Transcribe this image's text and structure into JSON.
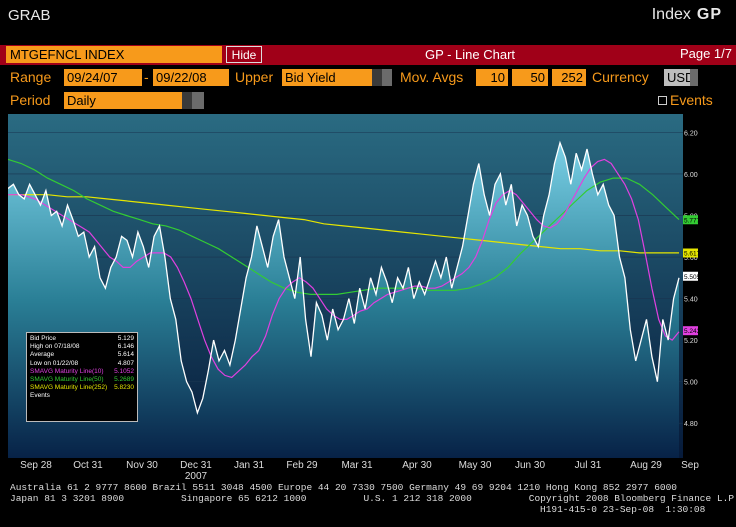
{
  "header": {
    "app_label": "GRAB",
    "index_label": "Index",
    "index_code": "GP"
  },
  "toolbar": {
    "ticker": "MTGEFNCL INDEX",
    "hide_label": "Hide",
    "chart_title": "GP - Line Chart",
    "page": "Page 1/7"
  },
  "controls": {
    "range_label": "Range",
    "range_start": "09/24/07",
    "range_sep": "-",
    "range_end": "09/22/08",
    "upper_label": "Upper",
    "upper_value": "Bid Yield",
    "movavg_label": "Mov. Avgs",
    "movavg_1": "10",
    "movavg_2": "50",
    "movavg_3": "252",
    "currency_label": "Currency",
    "currency_value": "USD",
    "period_label": "Period",
    "period_value": "Daily",
    "events_label": "Events"
  },
  "legend": [
    {
      "label": "Bid Price",
      "value": "5.129",
      "color": "#ffffff"
    },
    {
      "label": "High on 07/18/08",
      "value": "6.146",
      "color": "#ffffff"
    },
    {
      "label": "Average",
      "value": "5.614",
      "color": "#ffffff"
    },
    {
      "label": "Low on 01/22/08",
      "value": "4.807",
      "color": "#ffffff"
    },
    {
      "label": "SMAVG Maturity Line(10)",
      "value": "5.1052",
      "color": "#e040e0"
    },
    {
      "label": "SMAVG Maturity Line(50)",
      "value": "5.2689",
      "color": "#33cc33"
    },
    {
      "label": "SMAVG Maturity Line(252)",
      "value": "5.8230",
      "color": "#e6e600"
    },
    {
      "label": "Events",
      "value": "",
      "color": "#ffffff"
    }
  ],
  "chart_data": {
    "type": "line",
    "y_ticks": [
      "6.200",
      "6.000",
      "5.800",
      "5.600",
      "5.400",
      "5.200",
      "5.000",
      "4.800"
    ],
    "ylim": [
      4.7,
      6.25
    ],
    "x_labels": [
      "Sep 28",
      "Oct 31",
      "Nov 30",
      "Dec 31",
      "Jan 31",
      "Feb 29",
      "Mar 31",
      "Apr 30",
      "May 30",
      "Jun 30",
      "Jul 31",
      "Aug 29",
      "Sep"
    ],
    "year_label": "2007",
    "right_markers": [
      {
        "text": "5.777",
        "color": "#33cc33"
      },
      {
        "text": "5.617",
        "color": "#e6e600"
      },
      {
        "text": "5.505",
        "color": "#ffffff"
      },
      {
        "text": "5.243",
        "color": "#e040e0"
      }
    ],
    "series": [
      {
        "name": "Bid Price",
        "color": "#ffffff",
        "values": [
          5.93,
          5.95,
          5.9,
          5.88,
          5.95,
          5.9,
          5.85,
          5.92,
          5.8,
          5.82,
          5.75,
          5.85,
          5.78,
          5.7,
          5.72,
          5.6,
          5.65,
          5.5,
          5.45,
          5.55,
          5.6,
          5.7,
          5.68,
          5.6,
          5.72,
          5.65,
          5.55,
          5.7,
          5.75,
          5.6,
          5.4,
          5.3,
          5.1,
          5.0,
          4.95,
          4.85,
          4.92,
          5.05,
          5.2,
          5.1,
          5.15,
          5.08,
          5.2,
          5.35,
          5.5,
          5.6,
          5.75,
          5.65,
          5.55,
          5.7,
          5.78,
          5.6,
          5.5,
          5.4,
          5.6,
          5.3,
          5.12,
          5.38,
          5.32,
          5.2,
          5.35,
          5.25,
          5.3,
          5.4,
          5.28,
          5.45,
          5.35,
          5.5,
          5.42,
          5.55,
          5.48,
          5.38,
          5.5,
          5.45,
          5.55,
          5.4,
          5.48,
          5.42,
          5.5,
          5.58,
          5.5,
          5.6,
          5.45,
          5.55,
          5.65,
          5.8,
          5.95,
          6.05,
          5.9,
          5.8,
          5.95,
          6.0,
          5.85,
          5.95,
          5.75,
          5.85,
          5.8,
          5.7,
          5.65,
          5.8,
          5.9,
          6.05,
          6.15,
          6.08,
          5.95,
          6.1,
          6.02,
          6.12,
          6.0,
          5.9,
          5.95,
          5.85,
          5.8,
          5.6,
          5.5,
          5.25,
          5.1,
          5.2,
          5.3,
          5.12,
          5.0,
          5.3,
          5.2,
          5.4,
          5.5
        ]
      },
      {
        "name": "SMAVG Maturity Line(10)",
        "color": "#e040e0",
        "values": [
          5.9,
          5.9,
          5.9,
          5.89,
          5.88,
          5.86,
          5.84,
          5.82,
          5.8,
          5.78,
          5.76,
          5.74,
          5.72,
          5.68,
          5.64,
          5.6,
          5.58,
          5.55,
          5.55,
          5.58,
          5.6,
          5.62,
          5.62,
          5.62,
          5.6,
          5.55,
          5.48,
          5.4,
          5.3,
          5.2,
          5.12,
          5.06,
          5.03,
          5.02,
          5.05,
          5.08,
          5.12,
          5.15,
          5.22,
          5.32,
          5.4,
          5.45,
          5.48,
          5.5,
          5.48,
          5.45,
          5.4,
          5.35,
          5.32,
          5.3,
          5.3,
          5.32,
          5.34,
          5.35,
          5.38,
          5.4,
          5.42,
          5.43,
          5.44,
          5.45,
          5.46,
          5.46,
          5.45,
          5.45,
          5.46,
          5.48,
          5.5,
          5.52,
          5.55,
          5.6,
          5.68,
          5.78,
          5.86,
          5.9,
          5.92,
          5.9,
          5.86,
          5.82,
          5.78,
          5.75,
          5.74,
          5.76,
          5.8,
          5.86,
          5.92,
          5.98,
          6.03,
          6.06,
          6.07,
          6.05,
          6.0,
          5.95,
          5.88,
          5.78,
          5.62,
          5.45,
          5.3,
          5.22,
          5.2,
          5.24
        ]
      },
      {
        "name": "SMAVG Maturity Line(50)",
        "color": "#33cc33",
        "values": [
          6.07,
          6.05,
          6.02,
          5.98,
          5.95,
          5.92,
          5.88,
          5.85,
          5.82,
          5.8,
          5.78,
          5.76,
          5.75,
          5.73,
          5.7,
          5.67,
          5.64,
          5.6,
          5.56,
          5.52,
          5.48,
          5.45,
          5.43,
          5.42,
          5.42,
          5.42,
          5.43,
          5.44,
          5.45,
          5.45,
          5.45,
          5.45,
          5.44,
          5.44,
          5.44,
          5.45,
          5.47,
          5.5,
          5.55,
          5.62,
          5.68,
          5.74,
          5.8,
          5.86,
          5.92,
          5.96,
          5.98,
          5.98,
          5.95,
          5.9,
          5.84,
          5.78
        ]
      },
      {
        "name": "SMAVG Maturity Line(252)",
        "color": "#e6e600",
        "values": [
          5.9,
          5.9,
          5.9,
          5.89,
          5.89,
          5.88,
          5.87,
          5.86,
          5.85,
          5.84,
          5.83,
          5.82,
          5.81,
          5.8,
          5.79,
          5.78,
          5.76,
          5.75,
          5.74,
          5.73,
          5.72,
          5.71,
          5.7,
          5.69,
          5.68,
          5.67,
          5.66,
          5.65,
          5.64,
          5.64,
          5.63,
          5.63,
          5.62,
          5.62,
          5.62
        ]
      }
    ]
  },
  "footer": {
    "line1": "Australia 61 2 9777 8600 Brazil 5511 3048 4500 Europe 44 20 7330 7500 Germany 49 69 9204 1210 Hong Kong 852 2977 6000",
    "line2": "Japan 81 3 3201 8900          Singapore 65 6212 1000          U.S. 1 212 318 2000          Copyright 2008 Bloomberg Finance L.P.",
    "line3": "H191-415-0 23-Sep-08  1:30:08"
  }
}
